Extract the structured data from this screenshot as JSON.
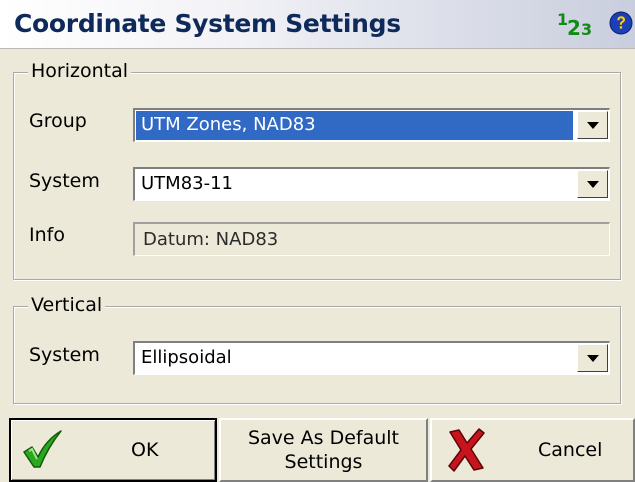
{
  "window": {
    "title": "Coordinate System Settings",
    "numeric_icon": {
      "d1": "1",
      "d2": "2",
      "d3": "3"
    },
    "help_icon": "help-icon"
  },
  "horizontal": {
    "legend": "Horizontal",
    "group_label": "Group",
    "group_value": "UTM Zones, NAD83",
    "system_label": "System",
    "system_value": "UTM83-11",
    "info_label": "Info",
    "info_value": "Datum: NAD83"
  },
  "vertical": {
    "legend": "Vertical",
    "system_label": "System",
    "system_value": "Ellipsoidal"
  },
  "buttons": {
    "ok_label": "OK",
    "save_default_line1": "Save As Default",
    "save_default_line2": "Settings",
    "cancel_label": "Cancel"
  },
  "colors": {
    "title_text": "#0e2a5a",
    "selection": "#316ac5",
    "ok_check": "#2aa81e",
    "cancel_x": "#c8141c",
    "help_blue": "#1c3fb8"
  }
}
